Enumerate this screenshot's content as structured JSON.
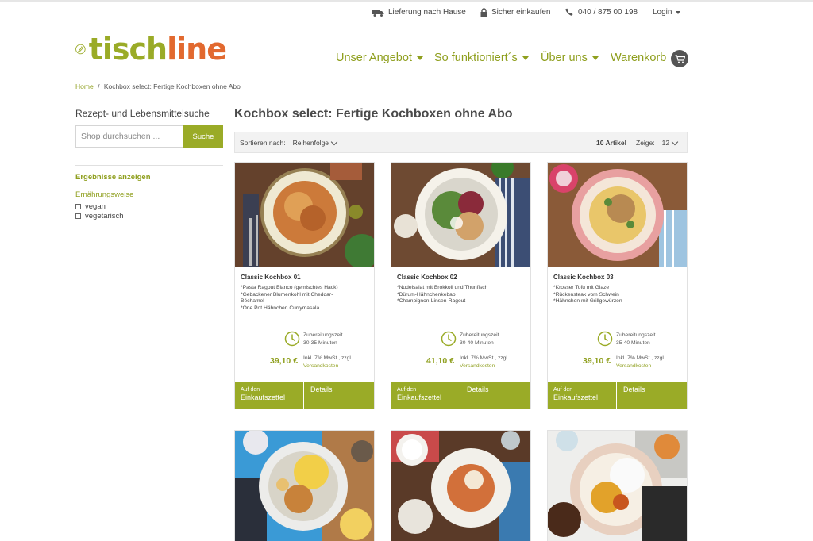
{
  "top_bar": {
    "delivery": "Lieferung nach Hause",
    "secure": "Sicher einkaufen",
    "phone": "040 / 875 00 198",
    "login": "Login"
  },
  "brand": {
    "part1": "tisch",
    "part2": "line"
  },
  "nav": {
    "offer": "Unser Angebot",
    "how": "So funktioniert´s",
    "about": "Über uns",
    "cart": "Warenkorb"
  },
  "breadcrumb": {
    "home": "Home",
    "separator": "/",
    "current": "Kochbox select: Fertige Kochboxen ohne Abo"
  },
  "sidebar": {
    "title": "Rezept- und Lebensmittelsuche",
    "search_placeholder": "Shop durchsuchen ...",
    "search_button": "Suche",
    "results": "Ergebnisse anzeigen",
    "diet_heading": "Ernährungsweise",
    "filters": [
      "vegan",
      "vegetarisch"
    ]
  },
  "main": {
    "title": "Kochbox select: Fertige Kochboxen ohne Abo",
    "sort_label": "Sortieren nach:",
    "sort_value": "Reihenfolge",
    "count": "10 Artikel",
    "show_label": "Zeige:",
    "show_value": "12"
  },
  "products": [
    {
      "name": "Classic Kochbox 01",
      "items": [
        "*Pasta Ragout Bianco (gemischtes Hack)",
        "*Gebackener Blumenkohl mit Cheddar-",
        "Béchamel",
        "*One Pot Hähnchen Currymasala"
      ],
      "prep_label": "Zubereitungszeit",
      "prep_time": "30-35 Minuten",
      "price": "39,10 €",
      "tax": "Inkl. 7% MwSt., zzgl.",
      "shipping": "Versandkosten",
      "add_small": "Auf den",
      "add_big": "Einkaufszettel",
      "details": "Details"
    },
    {
      "name": "Classic Kochbox 02",
      "items": [
        "*Nudelsalat mit Brokkoli und Thunfisch",
        "*Dürum-Hähnchenkebab",
        "*Champignon-Linsen-Ragout"
      ],
      "prep_label": "Zubereitungszeit",
      "prep_time": "30-40 Minuten",
      "price": "41,10 €",
      "tax": "Inkl. 7% MwSt., zzgl.",
      "shipping": "Versandkosten",
      "add_small": "Auf den",
      "add_big": "Einkaufszettel",
      "details": "Details"
    },
    {
      "name": "Classic Kochbox 03",
      "items": [
        "*Krosser Tofu mit Glaze",
        "*Rückensteak vom Schwein",
        "*Hähnchen mit Grillgewürzen"
      ],
      "prep_label": "Zubereitungszeit",
      "prep_time": "35-40 Minuten",
      "price": "39,10 €",
      "tax": "Inkl. 7% MwSt., zzgl.",
      "shipping": "Versandkosten",
      "add_small": "Auf den",
      "add_big": "Einkaufszettel",
      "details": "Details"
    }
  ],
  "colors": {
    "accent": "#9aab27",
    "accent_text": "#8f9f1e",
    "brand_orange": "#e2692f",
    "heading": "#4a4a4a"
  },
  "icons": [
    "truck-icon",
    "lock-icon",
    "phone-icon",
    "caret-down-icon",
    "cart-icon",
    "clock-icon",
    "chevron-down-icon",
    "checkbox-icon"
  ]
}
